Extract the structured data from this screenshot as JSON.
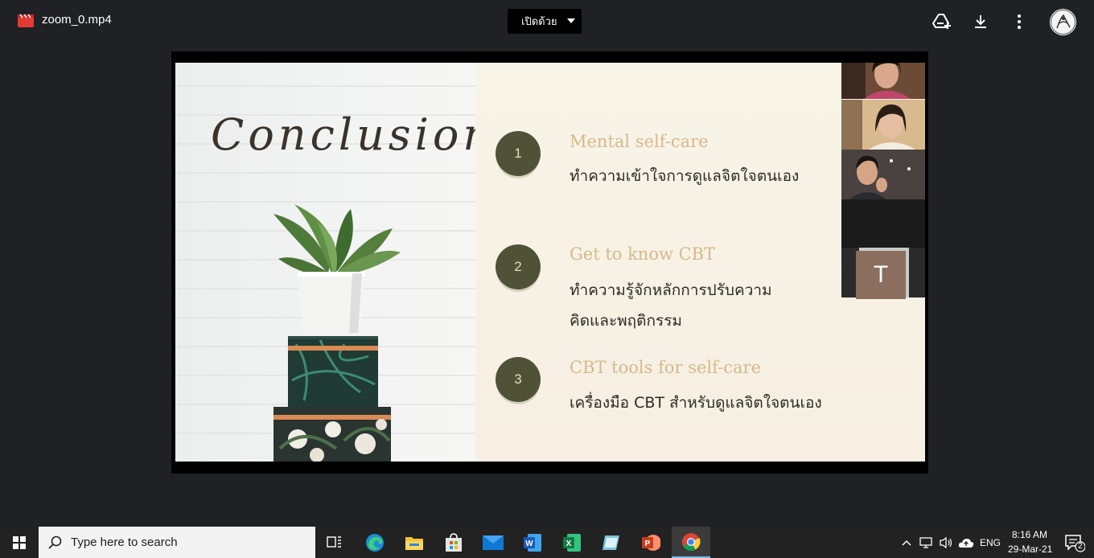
{
  "topbar": {
    "file_name": "zoom_0.mp4",
    "open_with_label": "เปิดด้วย",
    "icons": [
      "add-to-drive-icon",
      "download-icon",
      "more-vert-icon"
    ]
  },
  "slide": {
    "title": "Conclusion",
    "items": [
      {
        "number": "1",
        "title": "Mental self-care",
        "desc": [
          "ทำความเข้าใจการดูแลจิตใจตนเอง"
        ]
      },
      {
        "number": "2",
        "title": "Get to know CBT",
        "desc": [
          "ทำความรู้จักหลักการปรับความ",
          "คิดและพฤติกรรม"
        ]
      },
      {
        "number": "3",
        "title": "CBT tools for self-care",
        "desc": [
          "เครื่องมือ CBT สำหรับดูแลจิตใจตนเอง"
        ]
      }
    ],
    "participant_initial": "T"
  },
  "taskbar": {
    "search_placeholder": "Type here to search",
    "language": "ENG",
    "time": "8:16 AM",
    "date": "29-Mar-21",
    "notification_count": "2",
    "colors": {
      "accent_active": "#76b9ed"
    }
  }
}
